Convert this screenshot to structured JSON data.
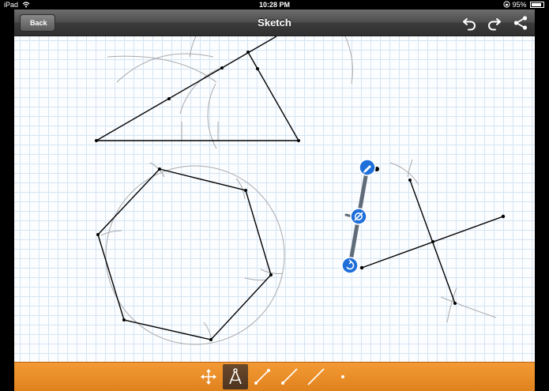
{
  "status_bar": {
    "device": "iPad",
    "time": "10:28 PM",
    "battery": "95%"
  },
  "nav": {
    "back_label": "Back",
    "title": "Sketch",
    "right_icons": [
      "undo-icon",
      "redo-icon",
      "share-icon"
    ]
  },
  "toolbar": {
    "tools": [
      {
        "name": "move",
        "icon": "move-arrows-icon",
        "selected": false
      },
      {
        "name": "compass",
        "icon": "compass-icon",
        "selected": true
      },
      {
        "name": "segment",
        "icon": "segment-tool-icon",
        "selected": false
      },
      {
        "name": "ray",
        "icon": "ray-tool-icon",
        "selected": false
      },
      {
        "name": "line",
        "icon": "line-tool-icon",
        "selected": false
      },
      {
        "name": "point",
        "icon": "point-tool-icon",
        "selected": false
      }
    ]
  },
  "colors": {
    "toolbar": "#e98a24",
    "selection_handle": "#1e6fd9",
    "grid": "#d6e4f2",
    "construction_arc": "#aaaaaa",
    "drawn_line": "#000000"
  }
}
